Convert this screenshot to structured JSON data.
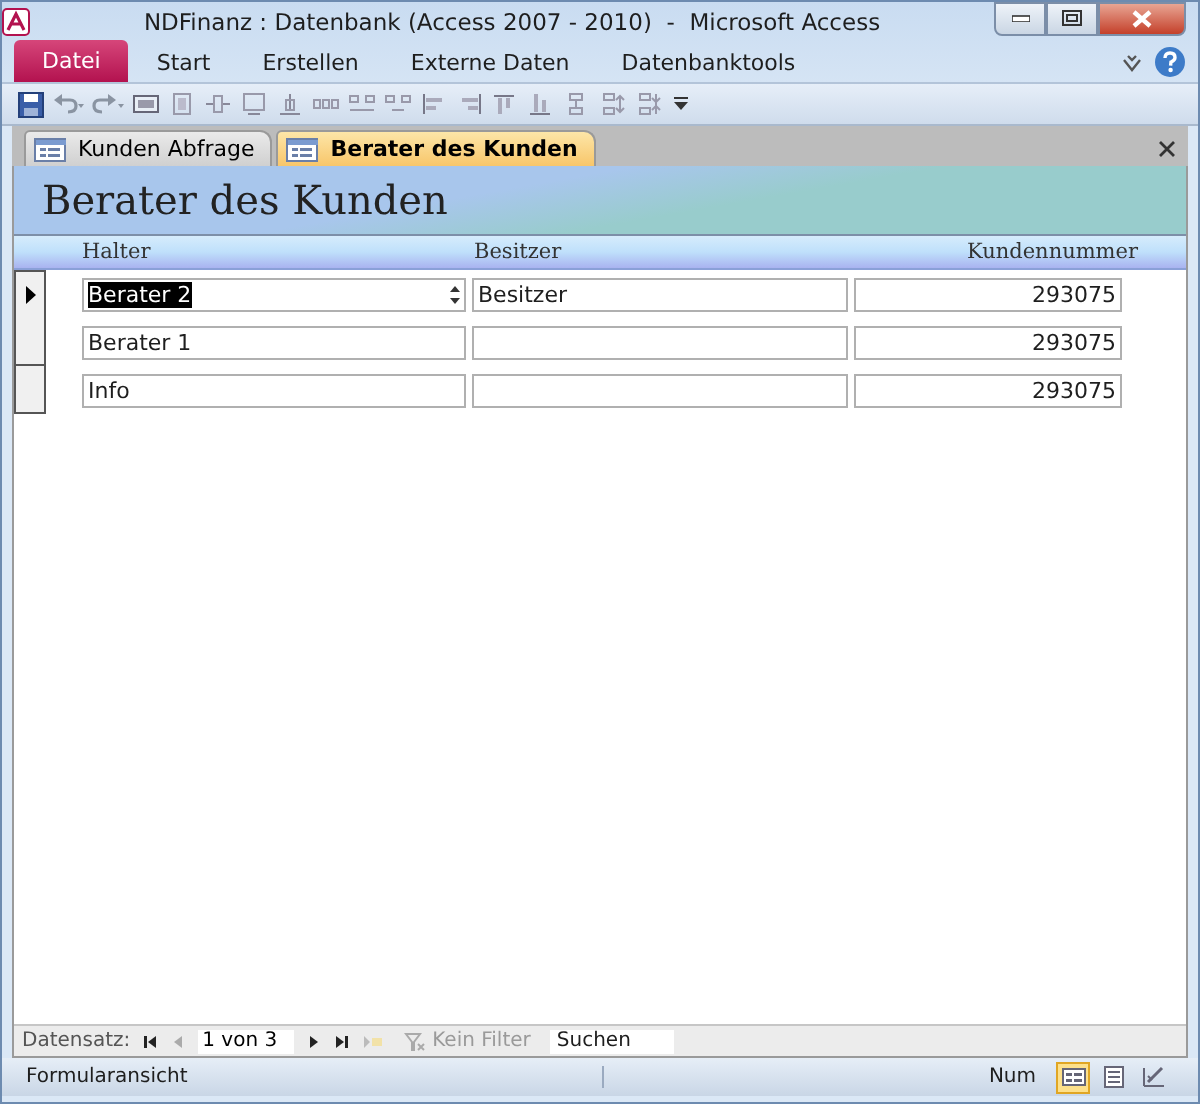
{
  "window": {
    "title": "NDFinanz : Datenbank (Access 2007 - 2010)  -  Microsoft Access"
  },
  "ribbon_tabs": [
    {
      "label": "Datei",
      "selected": true
    },
    {
      "label": "Start",
      "selected": false
    },
    {
      "label": "Erstellen",
      "selected": false
    },
    {
      "label": "Externe Daten",
      "selected": false
    },
    {
      "label": "Datenbanktools",
      "selected": false
    }
  ],
  "document_tabs": [
    {
      "label": "Kunden Abfrage",
      "selected": false
    },
    {
      "label": "Berater des Kunden",
      "selected": true
    }
  ],
  "form": {
    "title": "Berater des Kunden",
    "columns": [
      "Halter",
      "Besitzer",
      "Kundennummer"
    ],
    "rows": [
      {
        "selected": true,
        "halter": "Berater 2",
        "besitzer": "Besitzer",
        "kundennummer": "293075"
      },
      {
        "selected": false,
        "halter": "Berater 1",
        "kundennummer": "293075"
      },
      {
        "selected": false,
        "halter": "Info",
        "kundennummer": "293075"
      }
    ]
  },
  "navigation": {
    "label": "Datensatz:",
    "position": "1 von 3",
    "filter": "Kein Filter",
    "search": {
      "placeholder": "Suchen"
    }
  },
  "status_bar": {
    "text": "Formularansicht",
    "indicator": "Num",
    "views": [
      {
        "selected": true
      },
      {
        "selected": false
      },
      {
        "selected": false
      }
    ]
  }
}
